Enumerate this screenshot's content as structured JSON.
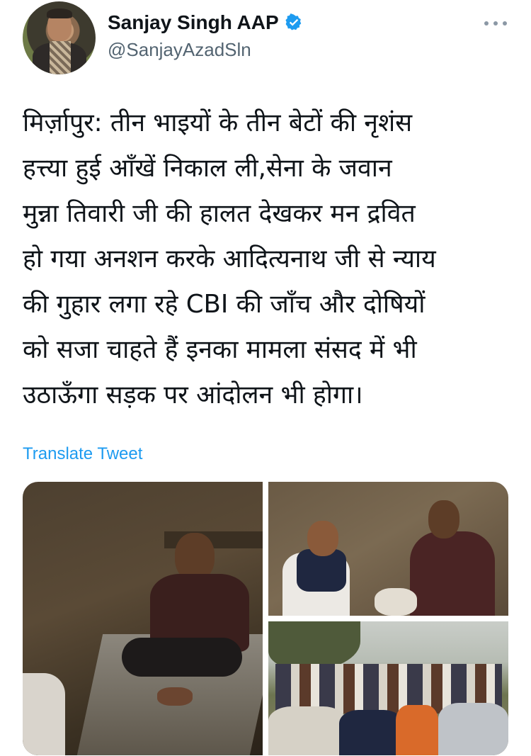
{
  "author": {
    "display_name": "Sanjay Singh AAP",
    "handle": "@SanjayAzadSln",
    "verified": true,
    "avatar_icon": "profile-photo"
  },
  "tweet": {
    "text": "मिर्ज़ापुर: तीन भाइयों के तीन बेटों की नृशंस\nहत्त्या हुई आँखें निकाल ली,सेना के जवान\nमुन्ना तिवारी जी की हालत देखकर मन द्रवित\nहो गया अनशन करके आदित्यनाथ जी से न्याय\nकी गुहार लगा रहे CBI की जाँच और दोषियों\nको सजा चाहते हैं इनका मामला संसद में भी\nउठाऊँगा सड़क पर आंदोलन भी होगा।",
    "translate_label": "Translate Tweet"
  },
  "icons": {
    "more": "more-dots-icon",
    "verified": "verified-badge-icon"
  },
  "colors": {
    "accent": "#1d9bf0",
    "secondary_text": "#536471",
    "primary_text": "#0f1419"
  }
}
